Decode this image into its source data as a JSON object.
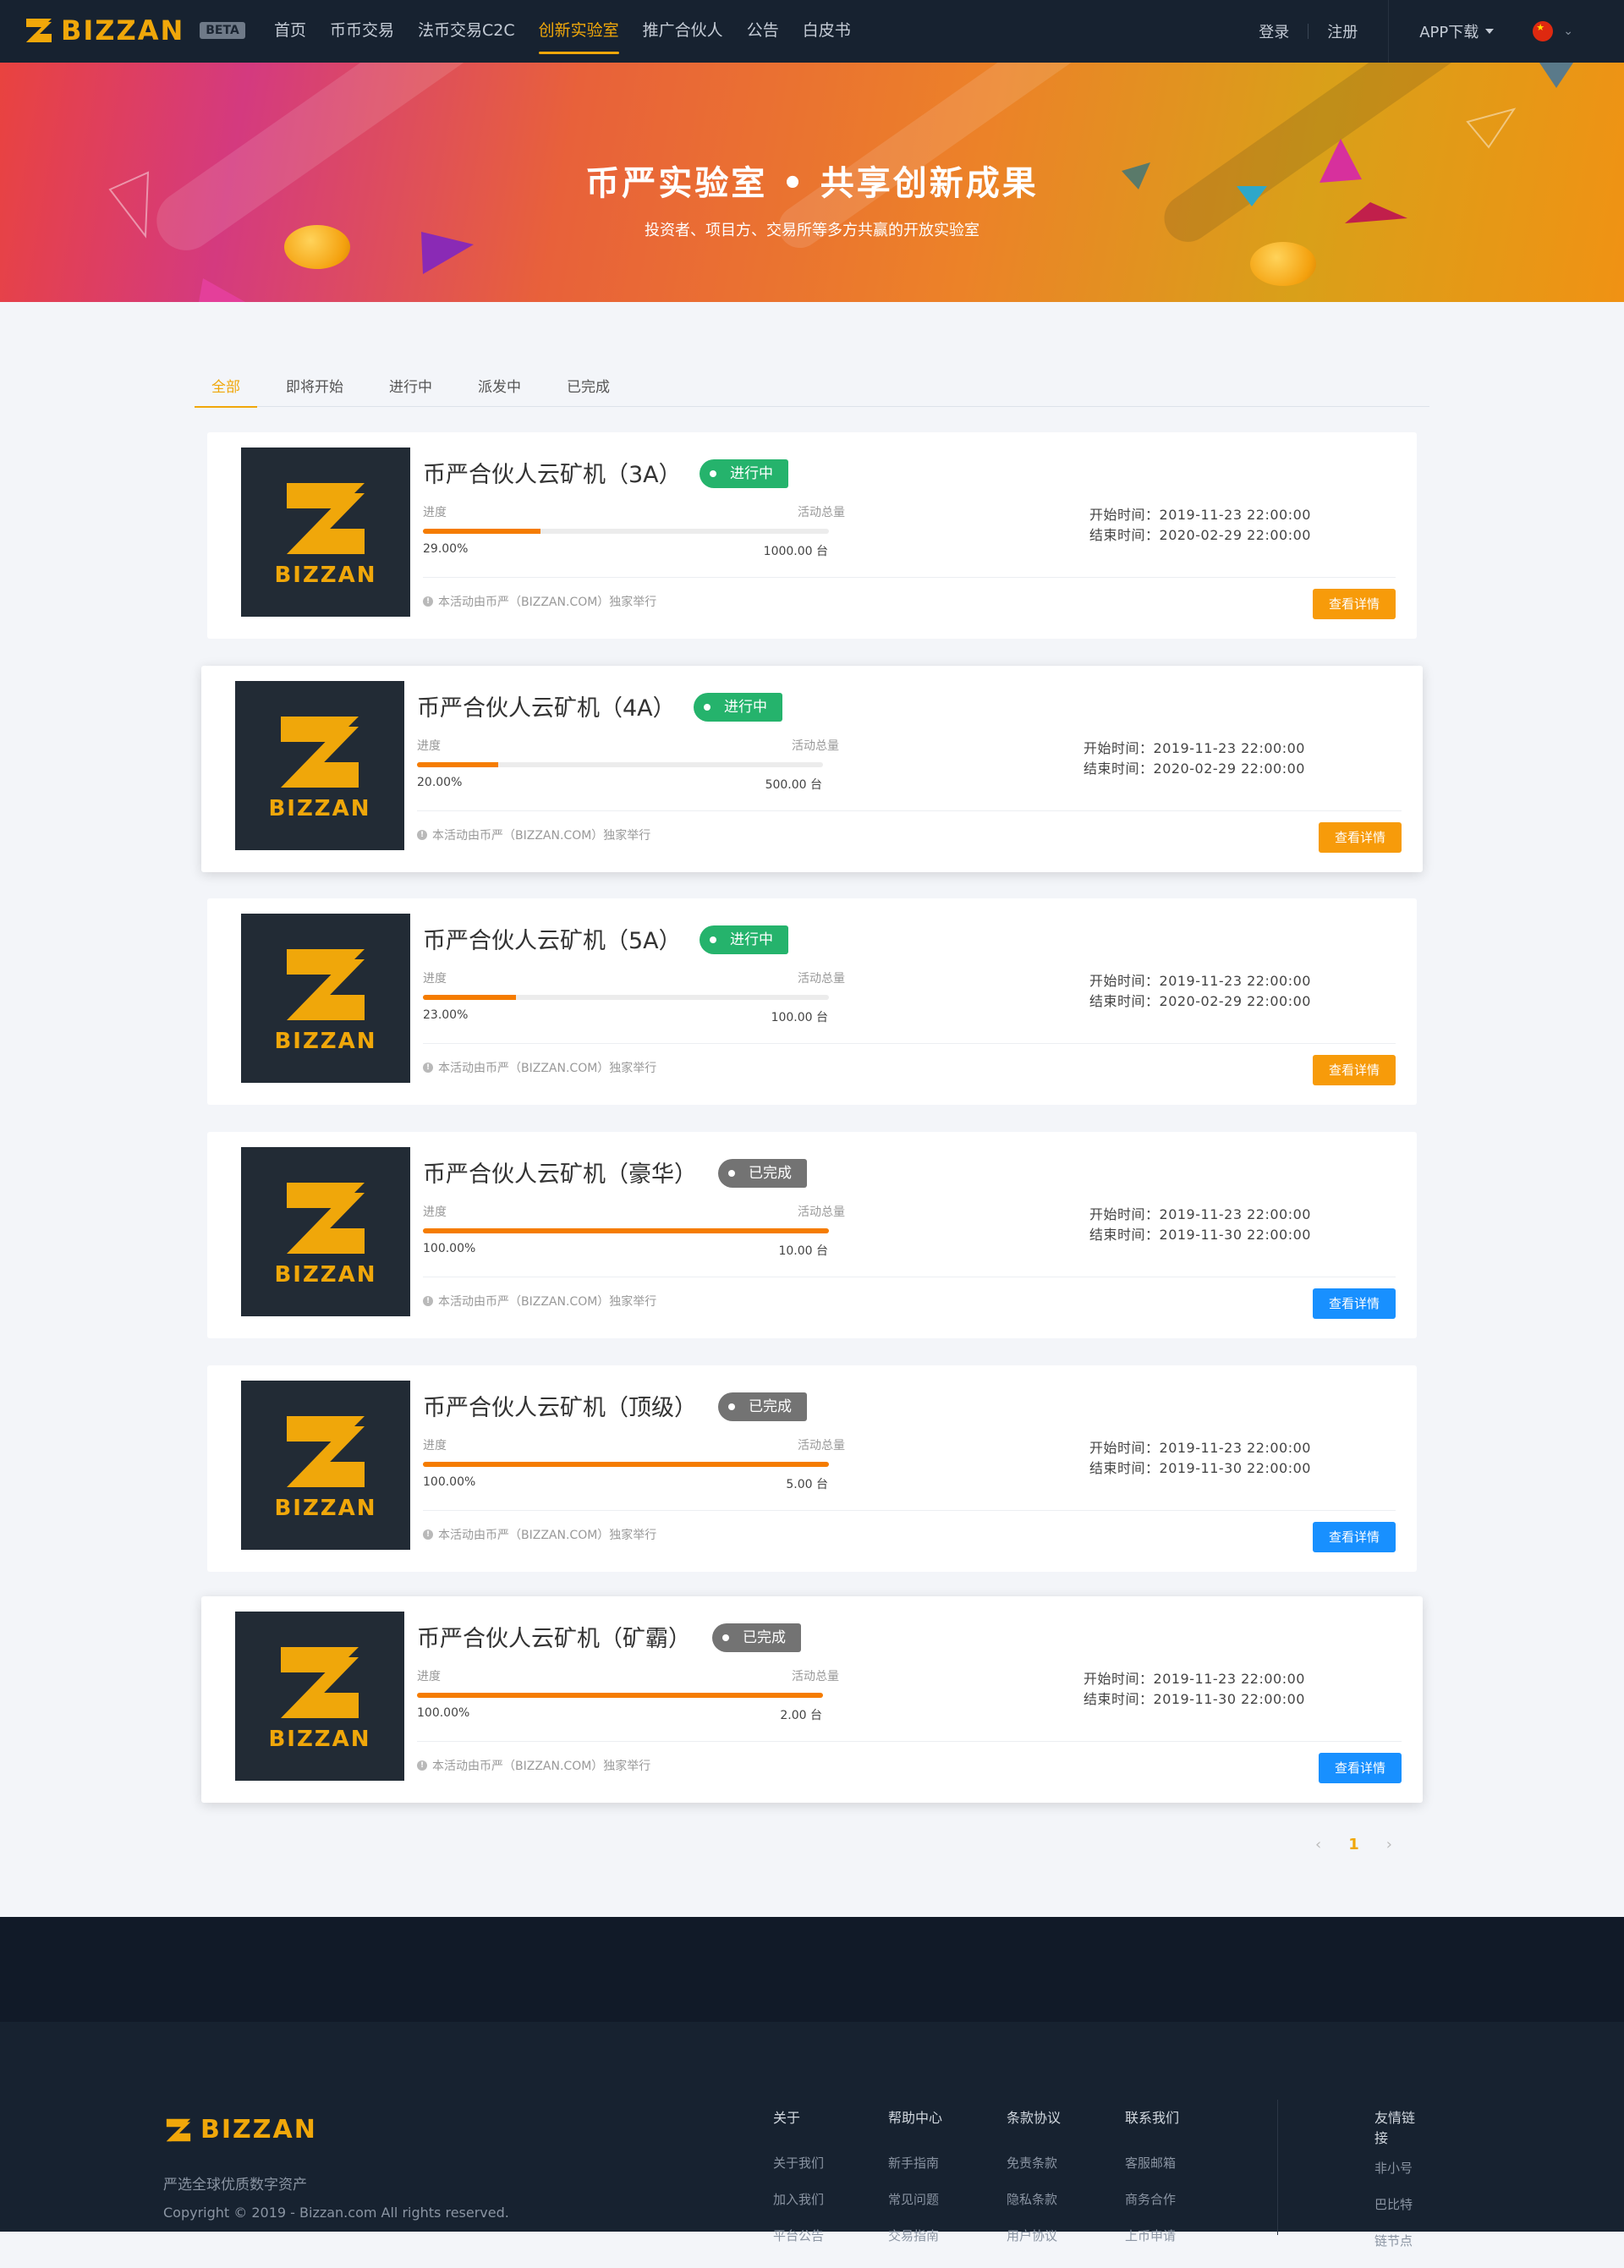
{
  "header": {
    "brand": "BIZZAN",
    "beta": "BETA",
    "nav": [
      "首页",
      "币币交易",
      "法币交易C2C",
      "创新实验室",
      "推广合伙人",
      "公告",
      "白皮书"
    ],
    "active_nav": "创新实验室",
    "login": "登录",
    "register": "注册",
    "app_download": "APP下载"
  },
  "banner": {
    "title": "币严实验室 • 共享创新成果",
    "subtitle": "投资者、项目方、交易所等多方共赢的开放实验室"
  },
  "tabs": [
    "全部",
    "即将开始",
    "进行中",
    "派发中",
    "已完成"
  ],
  "active_tab": "全部",
  "labels": {
    "progress": "进度",
    "total": "活动总量",
    "start_prefix": "开始时间：",
    "end_prefix": "结束时间：",
    "note": "本活动由币严（BIZZAN.COM）独家举行",
    "detail_button": "查看详情",
    "logo_word": "BIZZAN"
  },
  "activities": [
    {
      "title": "币严合伙人云矿机（3A）",
      "status": "进行中",
      "progress_pct": "29.00%",
      "progress": 0.29,
      "total": "1000.00 台",
      "start": "2019-11-23 22:00:00",
      "end": "2020-02-29 22:00:00",
      "button_color": "#f79b0a"
    },
    {
      "title": "币严合伙人云矿机（4A）",
      "status": "进行中",
      "progress_pct": "20.00%",
      "progress": 0.2,
      "total": "500.00 台",
      "start": "2019-11-23 22:00:00",
      "end": "2020-02-29 22:00:00",
      "button_color": "#f79b0a"
    },
    {
      "title": "币严合伙人云矿机（5A）",
      "status": "进行中",
      "progress_pct": "23.00%",
      "progress": 0.23,
      "total": "100.00 台",
      "start": "2019-11-23 22:00:00",
      "end": "2020-02-29 22:00:00",
      "button_color": "#f79b0a"
    },
    {
      "title": "币严合伙人云矿机（豪华）",
      "status": "已完成",
      "progress_pct": "100.00%",
      "progress": 1.0,
      "total": "10.00 台",
      "start": "2019-11-23 22:00:00",
      "end": "2019-11-30 22:00:00",
      "button_color": "#1890ff"
    },
    {
      "title": "币严合伙人云矿机（顶级）",
      "status": "已完成",
      "progress_pct": "100.00%",
      "progress": 1.0,
      "total": "5.00 台",
      "start": "2019-11-23 22:00:00",
      "end": "2019-11-30 22:00:00",
      "button_color": "#1890ff"
    },
    {
      "title": "币严合伙人云矿机（矿霸）",
      "status": "已完成",
      "progress_pct": "100.00%",
      "progress": 1.0,
      "total": "2.00 台",
      "start": "2019-11-23 22:00:00",
      "end": "2019-11-30 22:00:00",
      "button_color": "#1890ff"
    }
  ],
  "pagination": {
    "prev": "‹",
    "current": "1",
    "next": "›"
  },
  "footer": {
    "brand": "BIZZAN",
    "slogan": "严选全球优质数字资产",
    "copyright": "Copyright © 2019 - Bizzan.com All rights reserved.",
    "columns": [
      {
        "title": "关于",
        "links": [
          "关于我们",
          "加入我们",
          "平台公告"
        ]
      },
      {
        "title": "帮助中心",
        "links": [
          "新手指南",
          "常见问题",
          "交易指南"
        ]
      },
      {
        "title": "条款协议",
        "links": [
          "免责条款",
          "隐私条款",
          "用户协议"
        ]
      },
      {
        "title": "联系我们",
        "links": [
          "客服邮箱",
          "商务合作",
          "上币申请"
        ]
      },
      {
        "title": "友情链接",
        "links": [
          "非小号",
          "巴比特",
          "链节点"
        ]
      }
    ]
  },
  "colors": {
    "accent": "#f0a70a",
    "running": "#25b36c",
    "finished": "#737373",
    "progress": "#f57c00"
  }
}
